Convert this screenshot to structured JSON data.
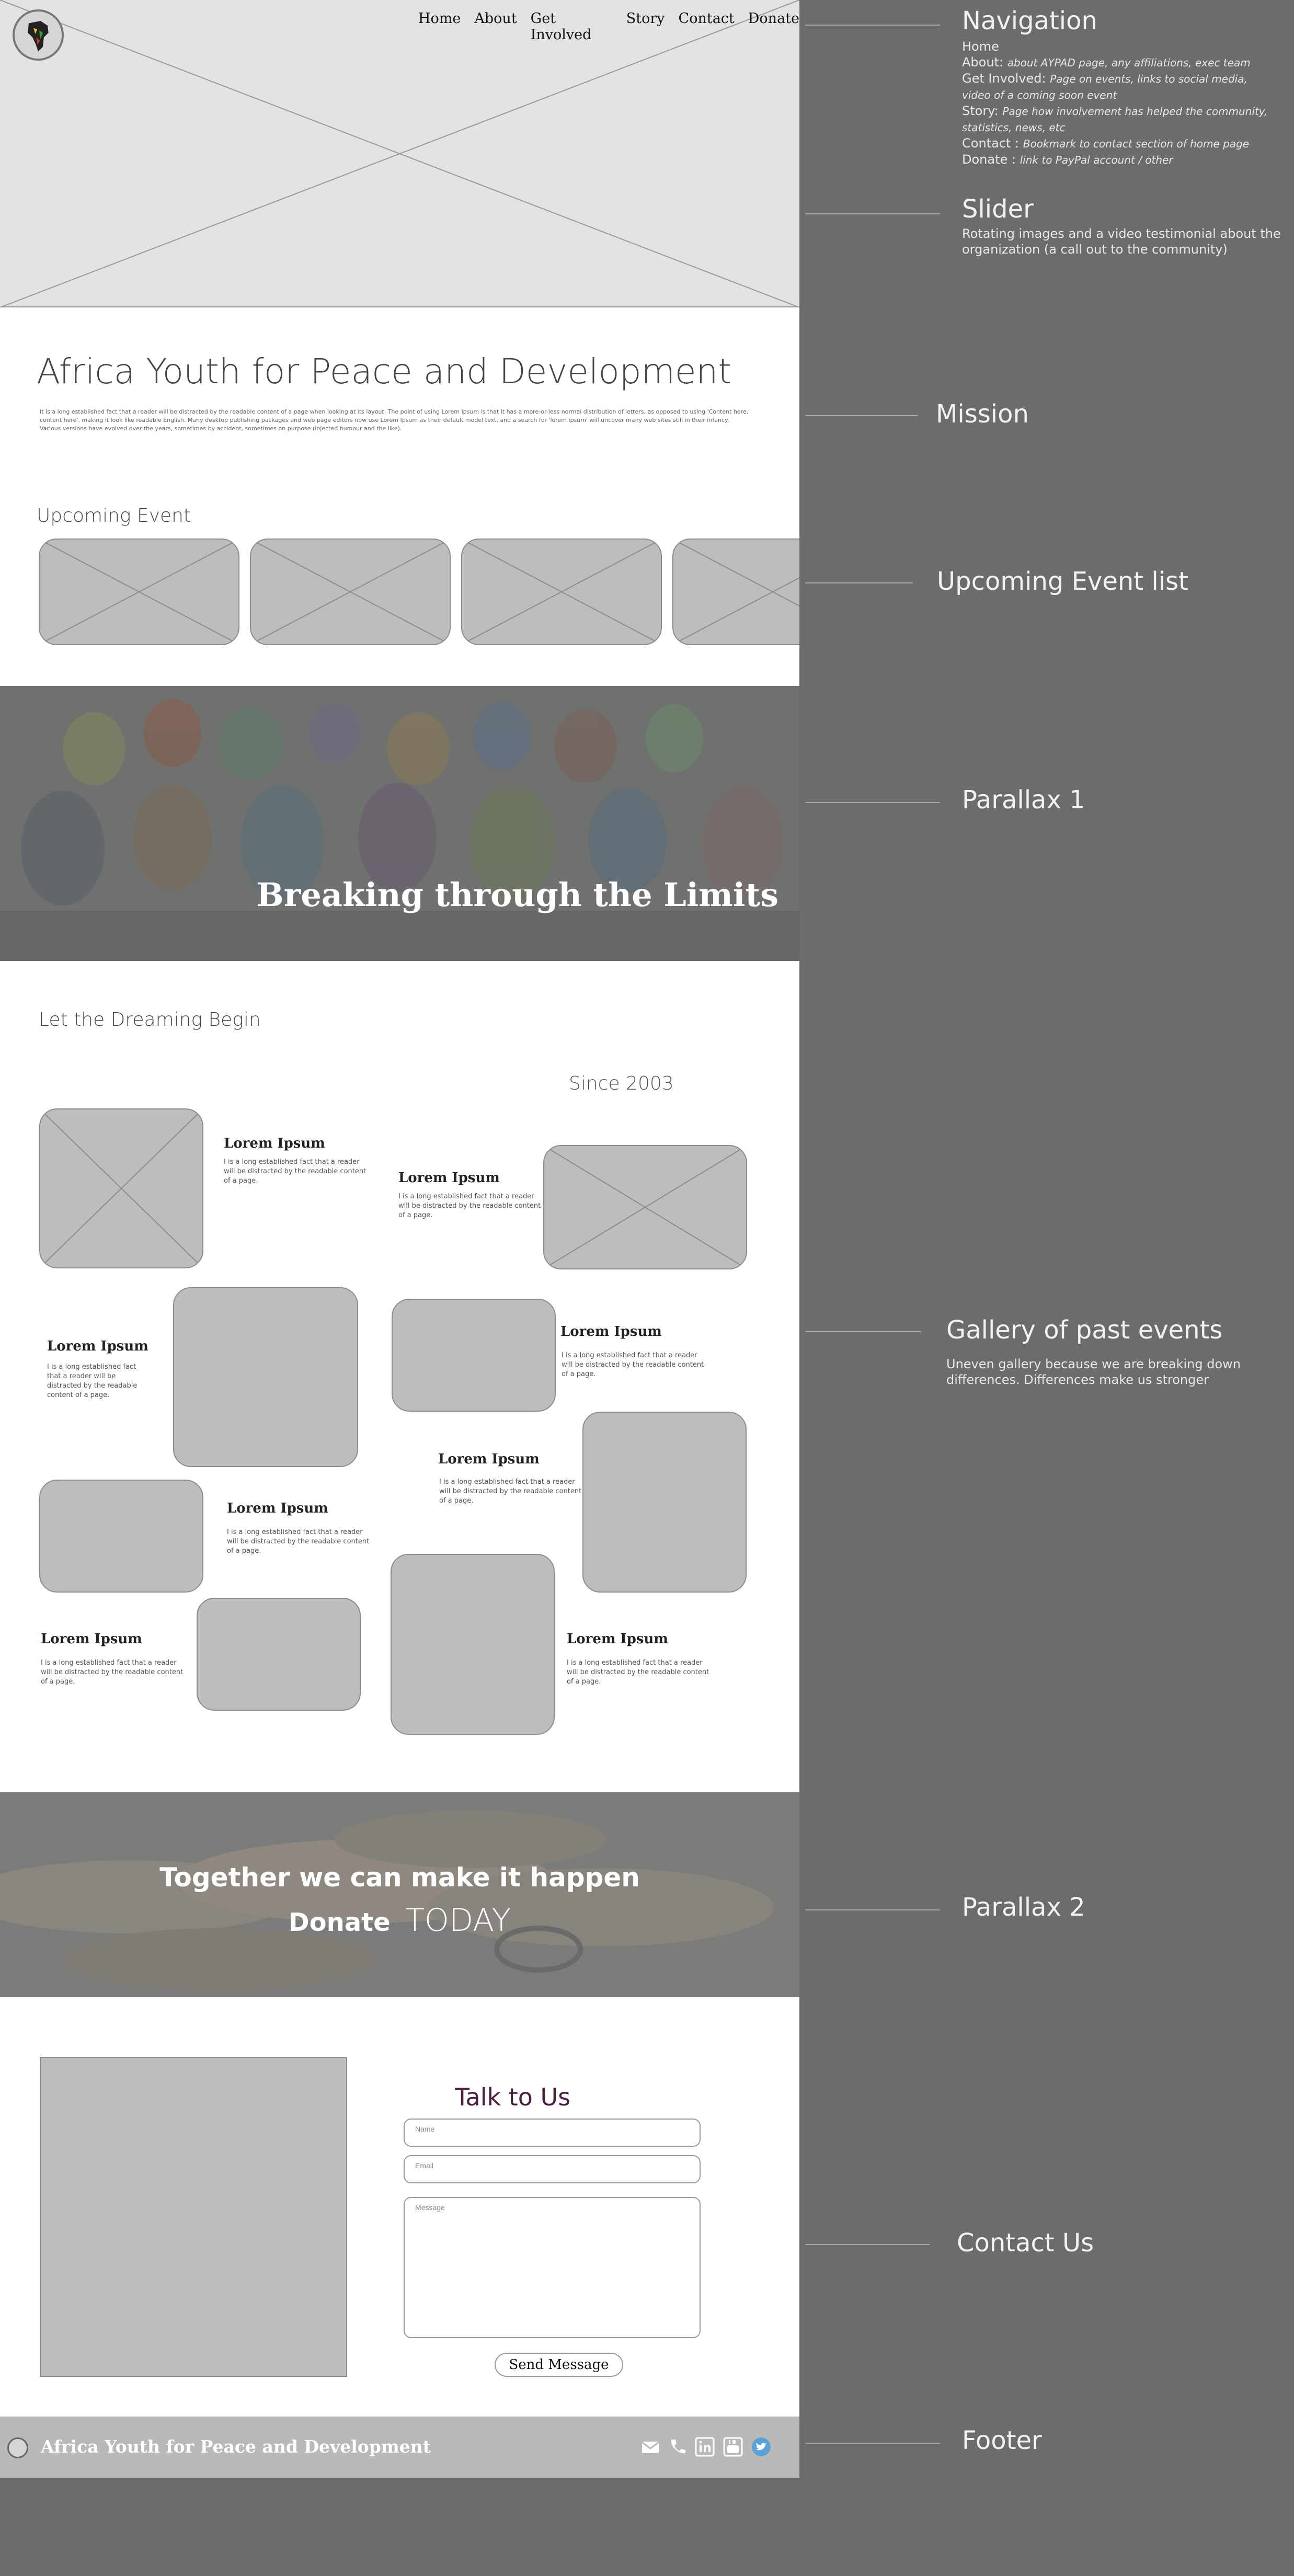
{
  "nav": {
    "items": [
      "Home",
      "About",
      "Get Involved",
      "Story",
      "Contact",
      "Donate"
    ]
  },
  "mission": {
    "title": "Africa Youth for Peace and Development",
    "body": "It is a long established fact that a reader will be distracted by the readable content of a page when looking at its layout. The point of using Lorem Ipsum is that it has a more-or-less normal distribution of letters, as opposed to using 'Content here, content here', making it look like readable English. Many desktop publishing packages and web page editors now use Lorem Ipsum as their default model text, and a search for 'lorem ipsum' will uncover many web sites still in their infancy. Various versions have evolved over the years, sometimes by accident, sometimes on purpose (injected humour and the like)."
  },
  "events": {
    "heading": "Upcoming Event"
  },
  "parallax1": {
    "text": "Breaking through the Limits"
  },
  "gallery": {
    "heading": "Let the Dreaming Begin",
    "since": "Since 2003",
    "item_title": "Lorem Ipsum",
    "item_text": "I is a long established fact that a reader will be distracted by the readable content of a page."
  },
  "parallax2": {
    "line1": "Together we can make it happen",
    "donate": "Donate",
    "today": "TODAY"
  },
  "contact": {
    "heading": "Talk to Us",
    "name_placeholder": "Name",
    "email_placeholder": "Email",
    "message_placeholder": "Message",
    "send_label": "Send Message"
  },
  "footer": {
    "title": "Africa Youth for Peace and Development",
    "icons": [
      "mail-icon",
      "phone-icon",
      "linkedin-icon",
      "youtube-icon",
      "twitter-icon"
    ]
  },
  "annotations": {
    "navigation": {
      "title": "Navigation",
      "lines": [
        {
          "label": "Home",
          "note": ""
        },
        {
          "label": "About:",
          "note": "about AYPAD page, any affiliations, exec team"
        },
        {
          "label": "Get Involved:",
          "note": "Page on events, links to social media, video of a coming soon event"
        },
        {
          "label": "Story:",
          "note": "Page how involvement has helped the community, statistics, news, etc"
        },
        {
          "label": "Contact :",
          "note": "Bookmark to contact section of home page"
        },
        {
          "label": "Donate :",
          "note": "link to PayPal account / other"
        }
      ]
    },
    "slider": {
      "title": "Slider",
      "text": "Rotating images and a video testimonial about the organization (a call out to the community)"
    },
    "mission": {
      "title": "Mission"
    },
    "event_list": {
      "title": "Upcoming Event list"
    },
    "parallax1": {
      "title": "Parallax 1"
    },
    "gallery": {
      "title": "Gallery of past events",
      "text": "Uneven gallery because we are breaking down differences. Differences make us stronger"
    },
    "parallax2": {
      "title": "Parallax 2"
    },
    "contact": {
      "title": "Contact Us"
    },
    "footer": {
      "title": "Footer"
    }
  },
  "colors": {
    "canvas": "#6b6c6b",
    "placeholder": "#bdbdbd",
    "contact_heading": "#4a1f3f",
    "footer_bg": "#b9b9b9",
    "twitter": "#5aa3d9"
  }
}
